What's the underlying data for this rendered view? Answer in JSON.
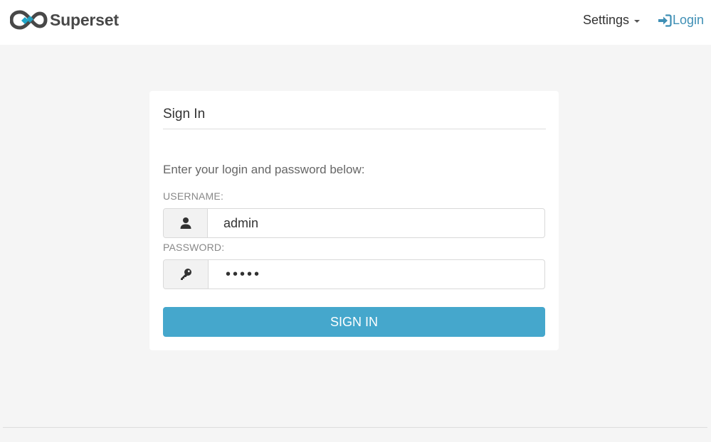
{
  "brand": {
    "name": "Superset",
    "icon": "superset-infinity-logo",
    "colors": {
      "dark": "#484848",
      "accent": "#20a7c9"
    }
  },
  "nav": {
    "settings_label": "Settings",
    "login_label": "Login",
    "login_icon": "sign-in-icon",
    "link_color": "#3f8fb5"
  },
  "form": {
    "title": "Sign In",
    "intro": "Enter your login and password below:",
    "username": {
      "label": "USERNAME:",
      "value": "admin",
      "icon": "user-icon"
    },
    "password": {
      "label": "PASSWORD:",
      "value": "•••••",
      "icon": "key-icon"
    },
    "submit_label": "SIGN IN",
    "submit_color": "#45a7cc"
  }
}
